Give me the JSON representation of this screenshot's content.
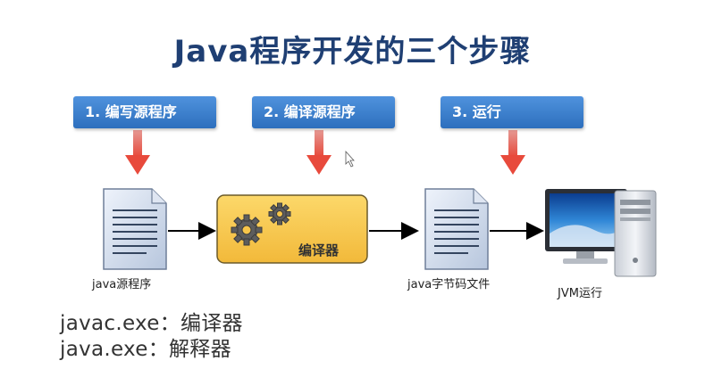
{
  "title": "Java程序开发的三个步骤",
  "steps": [
    {
      "label": "1. 编写源程序"
    },
    {
      "label": "2. 编译源程序"
    },
    {
      "label": "3. 运行"
    }
  ],
  "nodes": {
    "source_file": "java源程序",
    "compiler": "编译器",
    "bytecode_file": "java字节码文件",
    "jvm": "JVM运行"
  },
  "tools": [
    {
      "text": "javac.exe：编译器"
    },
    {
      "text": "java.exe：解释器"
    }
  ],
  "colors": {
    "title": "#1f3f73",
    "step_box": "#3a7fcc",
    "down_arrow": "#e0483a",
    "compiler_box": "#f7c54a",
    "flow_arrow": "#000000"
  }
}
